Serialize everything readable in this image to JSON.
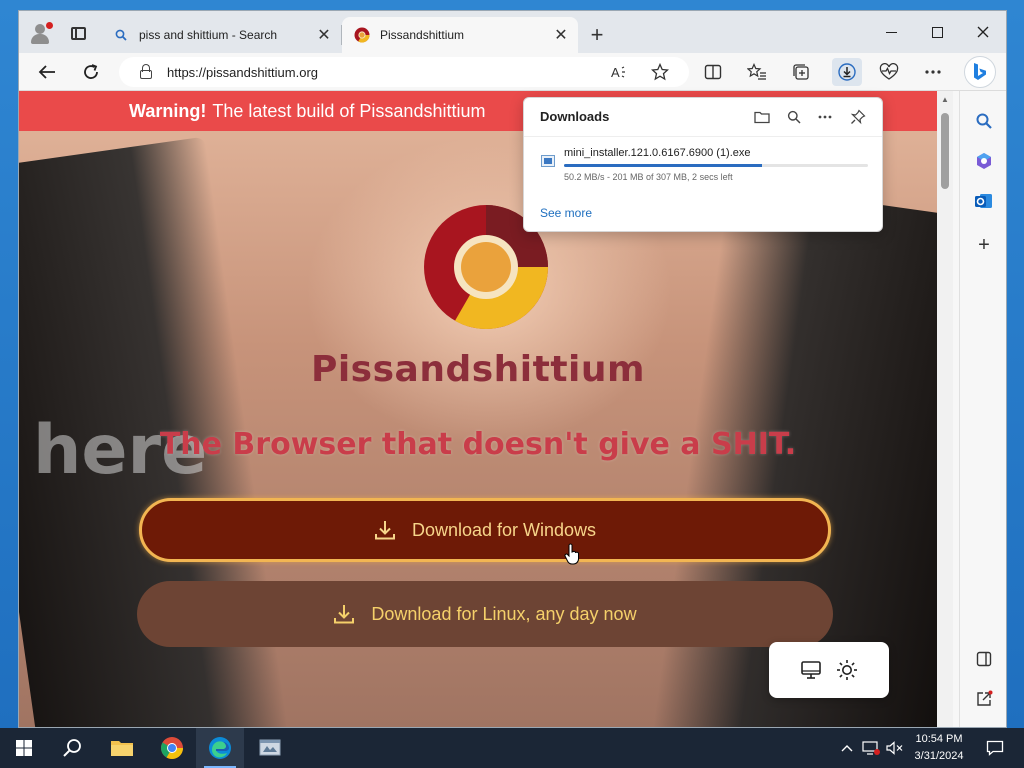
{
  "browser": {
    "tabs": [
      {
        "label": "piss and shittium - Search"
      },
      {
        "label": "Pissandshittium"
      }
    ],
    "address": {
      "url": "https://pissandshittium.org"
    }
  },
  "page": {
    "warning": {
      "bold": "Warning!",
      "text": "The latest build of Pissandshittium"
    },
    "brand": "Pissandshittium",
    "tagline": "The Browser that doesn't give a SHIT.",
    "download_windows": "Download for Windows",
    "download_linux": "Download for Linux, any day now"
  },
  "downloads": {
    "title": "Downloads",
    "file": {
      "name": "mini_installer.121.0.6167.6900 (1).exe",
      "status": "50.2 MB/s - 201 MB of 307 MB, 2 secs left",
      "progress": 0.65
    },
    "see_more": "See more"
  },
  "taskbar": {
    "time": "10:54 PM",
    "date": "3/31/2024"
  },
  "colors": {
    "warning_bg": "#ea4a4a",
    "brand": "#8c2e3b",
    "tagline": "#c93d4a",
    "win_button": "#6e1a06",
    "linux_button": "#6d4434",
    "link": "#1f6fbf"
  }
}
